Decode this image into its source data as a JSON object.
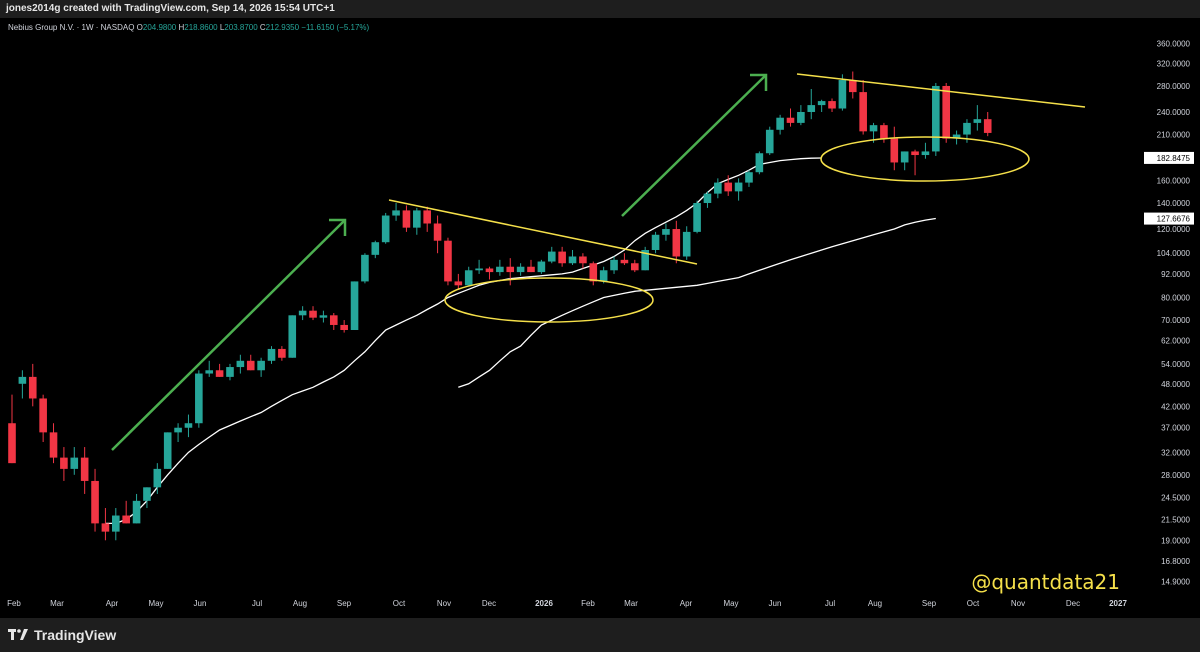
{
  "header": {
    "author_line": "jones2014g created with TradingView.com, Sep 14, 2026 15:54 UTC+1"
  },
  "legend": {
    "symbol": "Nebius Group N.V. · 1W · NASDAQ",
    "o_label": "O",
    "o_value": "204.9800",
    "h_label": "H",
    "h_value": "218.8600",
    "l_label": "L",
    "l_value": "203.8700",
    "c_label": "C",
    "c_value": "212.9350",
    "change": "−11.6150 (−5.17%)"
  },
  "watermark": "@quantdata21",
  "footer": {
    "brand": "TradingView"
  },
  "colors": {
    "up": "#26a69a",
    "down": "#f23645",
    "ma": "#ffffff",
    "trendline": "#f5e04a",
    "arrow": "#4caf50",
    "ellipse": "#f5e04a",
    "background": "#000000"
  },
  "chart_data": {
    "type": "candlestick",
    "y_scale": "log",
    "ylim": [
      13.5,
      390
    ],
    "y_tick_labels": [
      "360.0000",
      "320.0000",
      "280.0000",
      "240.0000",
      "210.0000",
      "180.0000",
      "160.0000",
      "140.0000",
      "120.0000",
      "104.0000",
      "92.0000",
      "80.0000",
      "70.0000",
      "62.0000",
      "54.0000",
      "48.0000",
      "42.0000",
      "37.0000",
      "32.0000",
      "28.0000",
      "24.5000",
      "21.5000",
      "19.0000",
      "16.8000",
      "14.9000"
    ],
    "x_tick_labels": [
      "Feb",
      "Mar",
      "Apr",
      "May",
      "Jun",
      "Jul",
      "Aug",
      "Sep",
      "Oct",
      "Nov",
      "Dec",
      "2026",
      "Feb",
      "Mar",
      "Apr",
      "May",
      "Jun",
      "Jul",
      "Aug",
      "Sep",
      "Oct",
      "Nov",
      "Dec",
      "2027"
    ],
    "price_labels": [
      {
        "value": "182.8475",
        "price": 182.85
      },
      {
        "value": "127.6676",
        "price": 127.67
      }
    ],
    "candles": [
      [
        38,
        45,
        30,
        30
      ],
      [
        48,
        52,
        44,
        50
      ],
      [
        50,
        54,
        42,
        44
      ],
      [
        44,
        45,
        34,
        36
      ],
      [
        36,
        38,
        30,
        31
      ],
      [
        31,
        33,
        27,
        29
      ],
      [
        29,
        33,
        28,
        31
      ],
      [
        31,
        33,
        25,
        27
      ],
      [
        27,
        29,
        20,
        21
      ],
      [
        21,
        23,
        19,
        20
      ],
      [
        20,
        23,
        19,
        22
      ],
      [
        22,
        24,
        21,
        21
      ],
      [
        21,
        25,
        21,
        24
      ],
      [
        24,
        26,
        23,
        26
      ],
      [
        26,
        30,
        25,
        29
      ],
      [
        29,
        36,
        29,
        36
      ],
      [
        36,
        38,
        34,
        37
      ],
      [
        37,
        40,
        35,
        38
      ],
      [
        38,
        52,
        37,
        51
      ],
      [
        51,
        55,
        50,
        52
      ],
      [
        52,
        54,
        50,
        50
      ],
      [
        50,
        54,
        49,
        53
      ],
      [
        53,
        57,
        51,
        55
      ],
      [
        55,
        57,
        52,
        52
      ],
      [
        52,
        56,
        50,
        55
      ],
      [
        55,
        60,
        54,
        59
      ],
      [
        59,
        60,
        55,
        56
      ],
      [
        56,
        72,
        56,
        72
      ],
      [
        72,
        76,
        70,
        74
      ],
      [
        74,
        76,
        70,
        71
      ],
      [
        71,
        74,
        69,
        72
      ],
      [
        72,
        73,
        66,
        68
      ],
      [
        68,
        70,
        65,
        66
      ],
      [
        66,
        88,
        66,
        88
      ],
      [
        88,
        104,
        87,
        103
      ],
      [
        103,
        112,
        101,
        111
      ],
      [
        111,
        132,
        110,
        130
      ],
      [
        130,
        140,
        126,
        134
      ],
      [
        134,
        138,
        118,
        121
      ],
      [
        121,
        136,
        116,
        134
      ],
      [
        134,
        137,
        118,
        124
      ],
      [
        124,
        130,
        104,
        112
      ],
      [
        112,
        114,
        86,
        88
      ],
      [
        88,
        92,
        84,
        86
      ],
      [
        86,
        96,
        86,
        94
      ],
      [
        94,
        100,
        92,
        95
      ],
      [
        95,
        96,
        89,
        93
      ],
      [
        93,
        100,
        91,
        96
      ],
      [
        96,
        101,
        86,
        93
      ],
      [
        93,
        98,
        91,
        96
      ],
      [
        96,
        100,
        93,
        93
      ],
      [
        93,
        100,
        92,
        99
      ],
      [
        99,
        108,
        98,
        105
      ],
      [
        105,
        108,
        96,
        98
      ],
      [
        98,
        106,
        97,
        102
      ],
      [
        102,
        104,
        95,
        98
      ],
      [
        98,
        99,
        86,
        88
      ],
      [
        88,
        96,
        87,
        94
      ],
      [
        94,
        102,
        92,
        100
      ],
      [
        100,
        104,
        97,
        98
      ],
      [
        98,
        100,
        93,
        94
      ],
      [
        94,
        108,
        94,
        106
      ],
      [
        106,
        118,
        104,
        116
      ],
      [
        116,
        124,
        112,
        120
      ],
      [
        120,
        126,
        98,
        102
      ],
      [
        102,
        122,
        100,
        118
      ],
      [
        118,
        142,
        117,
        140
      ],
      [
        140,
        150,
        136,
        148
      ],
      [
        148,
        162,
        144,
        158
      ],
      [
        158,
        165,
        146,
        150
      ],
      [
        150,
        162,
        142,
        158
      ],
      [
        158,
        170,
        154,
        168
      ],
      [
        168,
        190,
        166,
        188
      ],
      [
        188,
        220,
        186,
        216
      ],
      [
        216,
        236,
        210,
        232
      ],
      [
        232,
        245,
        220,
        225
      ],
      [
        225,
        250,
        222,
        240
      ],
      [
        240,
        275,
        230,
        250
      ],
      [
        250,
        258,
        240,
        256
      ],
      [
        256,
        260,
        240,
        245
      ],
      [
        245,
        300,
        242,
        290
      ],
      [
        290,
        305,
        260,
        270
      ],
      [
        270,
        290,
        210,
        214
      ],
      [
        214,
        225,
        200,
        222
      ],
      [
        222,
        225,
        200,
        205
      ],
      [
        205,
        220,
        170,
        178
      ],
      [
        178,
        190,
        170,
        190
      ],
      [
        190,
        192,
        165,
        186
      ],
      [
        186,
        200,
        182,
        190
      ],
      [
        190,
        285,
        185,
        280
      ],
      [
        280,
        285,
        200,
        205
      ],
      [
        205,
        215,
        198,
        210
      ],
      [
        210,
        230,
        200,
        225
      ],
      [
        225,
        250,
        215,
        230
      ],
      [
        230,
        240,
        208,
        212
      ]
    ],
    "ma_series": [
      {
        "name": "",
        "values": [
          21,
          21,
          21.5,
          22.5,
          24,
          26,
          28,
          30,
          32,
          33.5,
          35,
          36.5,
          37.5,
          38.5,
          39.5,
          40.5,
          42,
          43.5,
          45,
          46,
          47,
          48.5,
          50,
          52,
          55,
          58,
          62,
          66,
          68,
          70,
          72,
          74.5,
          77,
          80,
          82,
          84,
          86,
          87.5,
          88.5,
          89.5,
          90,
          90.5,
          91,
          91.5,
          92,
          93,
          95,
          97,
          99,
          102,
          106,
          112,
          117,
          121,
          125,
          129,
          134,
          140,
          149,
          157,
          161,
          165,
          170,
          176,
          178,
          180,
          181,
          182,
          182.5,
          182.8
        ]
      },
      {
        "name": "",
        "values": [
          47,
          48,
          50,
          52,
          55,
          58,
          60,
          64,
          68,
          70,
          72,
          74,
          76,
          78,
          80,
          81,
          82,
          83,
          83.5,
          84,
          84.5,
          85,
          85.5,
          86,
          87,
          88,
          89,
          90,
          92,
          94,
          96,
          98,
          100,
          102,
          104,
          106,
          108,
          110,
          112,
          114,
          116,
          118,
          120,
          123,
          125,
          126.5,
          127.7
        ]
      }
    ],
    "annotations": [
      "uptrend arrow 1",
      "uptrend arrow 2",
      "downtrend line 1",
      "downtrend line 2",
      "support ellipse 1",
      "support ellipse 2"
    ]
  }
}
